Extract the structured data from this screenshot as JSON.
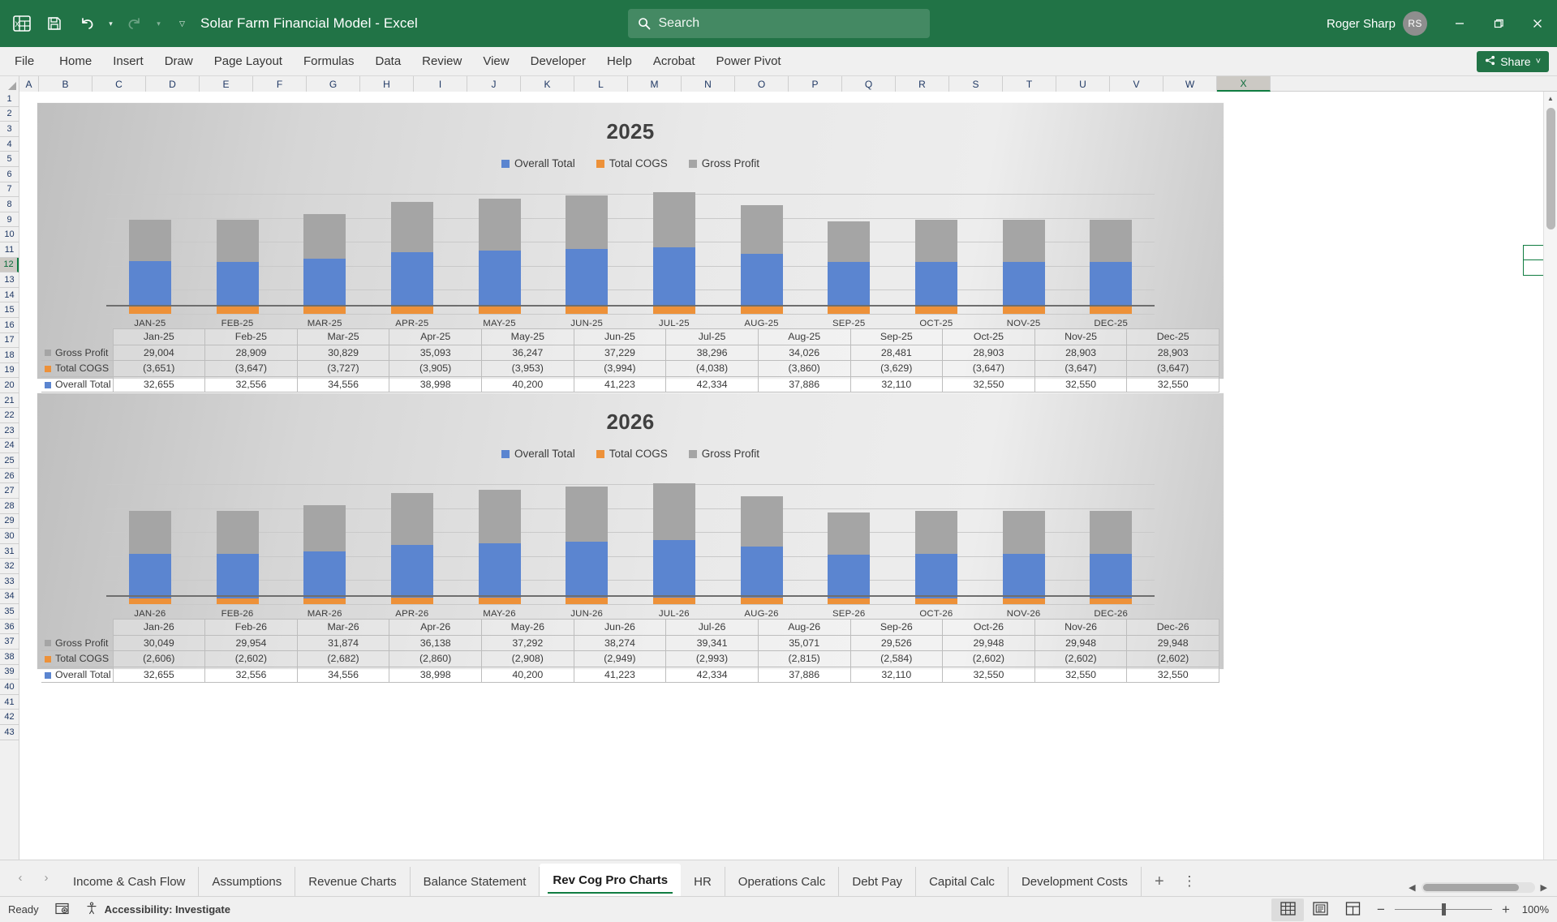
{
  "titlebar": {
    "document_title": "Solar Farm Financial Model  -  Excel",
    "save_icon": "save-icon",
    "undo_icon": "undo-icon",
    "redo_icon": "redo-icon",
    "customize_icon": "customize-quick-access-icon",
    "user_name": "Roger Sharp",
    "user_initials": "RS",
    "minimize_label": "—",
    "restore_label": "❐",
    "close_label": "✕"
  },
  "search": {
    "placeholder": "Search",
    "icon": "search-icon"
  },
  "ribbon": {
    "tabs": [
      "File",
      "Home",
      "Insert",
      "Draw",
      "Page Layout",
      "Formulas",
      "Data",
      "Review",
      "View",
      "Developer",
      "Help",
      "Acrobat",
      "Power Pivot"
    ],
    "share_label": "Share",
    "share_icon": "share-icon",
    "share_caret": "˅"
  },
  "grid": {
    "columns": [
      "A",
      "B",
      "C",
      "D",
      "E",
      "F",
      "G",
      "H",
      "I",
      "J",
      "K",
      "L",
      "M",
      "N",
      "O",
      "P",
      "Q",
      "R",
      "S",
      "T",
      "U",
      "V",
      "W",
      "X"
    ],
    "selected_column": "X",
    "rows": [
      1,
      2,
      3,
      4,
      5,
      6,
      7,
      8,
      9,
      10,
      11,
      12,
      13,
      14,
      15,
      16,
      17,
      18,
      19,
      20,
      21,
      22,
      23,
      24,
      25,
      26,
      27,
      28,
      29,
      30,
      31,
      32,
      33,
      34,
      35,
      36,
      37,
      38,
      39,
      40,
      41,
      42,
      43
    ],
    "selected_row": 12
  },
  "chart_data": [
    {
      "type": "bar",
      "title": "2025",
      "stacked": true,
      "xlabel": "",
      "ylabel": "",
      "grid": true,
      "legend_position": "top",
      "categories": [
        "JAN-25",
        "FEB-25",
        "MAR-25",
        "APR-25",
        "MAY-25",
        "JUN-25",
        "JUL-25",
        "AUG-25",
        "SEP-25",
        "OCT-25",
        "NOV-25",
        "DEC-25"
      ],
      "table_headers": [
        "Jan-25",
        "Feb-25",
        "Mar-25",
        "Apr-25",
        "May-25",
        "Jun-25",
        "Jul-25",
        "Aug-25",
        "Sep-25",
        "Oct-25",
        "Nov-25",
        "Dec-25"
      ],
      "series": [
        {
          "name": "Overall Total",
          "color": "#5b85d0",
          "values": [
            32655,
            32556,
            34556,
            38998,
            40200,
            41223,
            42334,
            37886,
            32110,
            32550,
            32550,
            32550
          ],
          "display": [
            "32,655",
            "32,556",
            "34,556",
            "38,998",
            "40,200",
            "41,223",
            "42,334",
            "37,886",
            "32,110",
            "32,550",
            "32,550",
            "32,550"
          ]
        },
        {
          "name": "Total COGS",
          "color": "#ed9139",
          "values": [
            -3651,
            -3647,
            -3727,
            -3905,
            -3953,
            -3994,
            -4038,
            -3860,
            -3629,
            -3647,
            -3647,
            -3647
          ],
          "display": [
            "(3,651)",
            "(3,647)",
            "(3,727)",
            "(3,905)",
            "(3,953)",
            "(3,994)",
            "(4,038)",
            "(3,860)",
            "(3,629)",
            "(3,647)",
            "(3,647)",
            "(3,647)"
          ]
        },
        {
          "name": "Gross Profit",
          "color": "#a5a5a5",
          "values": [
            29004,
            28909,
            30829,
            35093,
            36247,
            37229,
            38296,
            34026,
            28481,
            28903,
            28903,
            28903
          ],
          "display": [
            "29,004",
            "28,909",
            "30,829",
            "35,093",
            "36,247",
            "37,229",
            "38,296",
            "34,026",
            "28,481",
            "28,903",
            "28,903",
            "28,903"
          ]
        }
      ]
    },
    {
      "type": "bar",
      "title": "2026",
      "stacked": true,
      "xlabel": "",
      "ylabel": "",
      "grid": true,
      "legend_position": "top",
      "categories": [
        "JAN-26",
        "FEB-26",
        "MAR-26",
        "APR-26",
        "MAY-26",
        "JUN-26",
        "JUL-26",
        "AUG-26",
        "SEP-26",
        "OCT-26",
        "NOV-26",
        "DEC-26"
      ],
      "table_headers": [
        "Jan-26",
        "Feb-26",
        "Mar-26",
        "Apr-26",
        "May-26",
        "Jun-26",
        "Jul-26",
        "Aug-26",
        "Sep-26",
        "Oct-26",
        "Nov-26",
        "Dec-26"
      ],
      "series": [
        {
          "name": "Overall Total",
          "color": "#5b85d0",
          "values": [
            32655,
            32556,
            34556,
            38998,
            40200,
            41223,
            42334,
            37886,
            32110,
            32550,
            32550,
            32550
          ],
          "display": [
            "32,655",
            "32,556",
            "34,556",
            "38,998",
            "40,200",
            "41,223",
            "42,334",
            "37,886",
            "32,110",
            "32,550",
            "32,550",
            "32,550"
          ]
        },
        {
          "name": "Total COGS",
          "color": "#ed9139",
          "values": [
            -2606,
            -2602,
            -2682,
            -2860,
            -2908,
            -2949,
            -2993,
            -2815,
            -2584,
            -2602,
            -2602,
            -2602
          ],
          "display": [
            "(2,606)",
            "(2,602)",
            "(2,682)",
            "(2,860)",
            "(2,908)",
            "(2,949)",
            "(2,993)",
            "(2,815)",
            "(2,584)",
            "(2,602)",
            "(2,602)",
            "(2,602)"
          ]
        },
        {
          "name": "Gross Profit",
          "color": "#a5a5a5",
          "values": [
            30049,
            29954,
            31874,
            36138,
            37292,
            38274,
            39341,
            35071,
            29526,
            29948,
            29948,
            29948
          ],
          "display": [
            "30,049",
            "29,954",
            "31,874",
            "36,138",
            "37,292",
            "38,274",
            "39,341",
            "35,071",
            "29,526",
            "29,948",
            "29,948",
            "29,948"
          ]
        }
      ]
    }
  ],
  "sheet_tabs": {
    "prev_icon": "chevron-left-icon",
    "next_icon": "chevron-right-icon",
    "tabs": [
      "Income & Cash Flow",
      "Assumptions",
      "Revenue Charts",
      "Balance Statement",
      "Rev Cog Pro Charts",
      "HR",
      "Operations Calc",
      "Debt Pay",
      "Capital Calc",
      "Development Costs"
    ],
    "active_tab": "Rev Cog Pro Charts",
    "add_sheet_label": "+",
    "more_label": "⋮"
  },
  "statusbar": {
    "mode": "Ready",
    "macro_icon": "record-macro-icon",
    "accessibility_icon": "accessibility-icon",
    "accessibility_text": "Accessibility: Investigate",
    "views": [
      {
        "name": "normal-view",
        "icon": "grid-view-icon",
        "active": true
      },
      {
        "name": "page-layout-view",
        "icon": "page-layout-icon",
        "active": false
      },
      {
        "name": "page-break-view",
        "icon": "page-break-icon",
        "active": false
      }
    ],
    "zoom_out": "−",
    "zoom_in": "+",
    "zoom_level": "100%"
  },
  "colors": {
    "brand_green": "#217346",
    "accent_green": "#107c41",
    "series_blue": "#5b85d0",
    "series_orange": "#ed9139",
    "series_gray": "#a5a5a5"
  }
}
